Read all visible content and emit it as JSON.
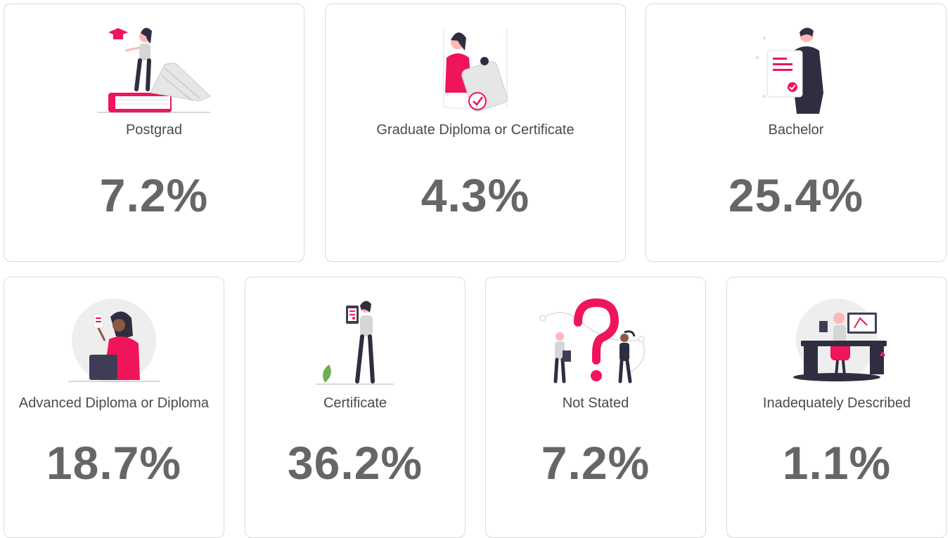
{
  "cards": [
    {
      "label": "Postgrad",
      "value": "7.2%",
      "illustration": "graduate-on-books-icon"
    },
    {
      "label": "Graduate Diploma or Certificate",
      "value": "4.3%",
      "illustration": "woman-holding-certificate-icon"
    },
    {
      "label": "Bachelor",
      "value": "25.4%",
      "illustration": "man-with-document-icon"
    },
    {
      "label": "Advanced Diploma or Diploma",
      "value": "18.7%",
      "illustration": "woman-at-laptop-icon"
    },
    {
      "label": "Certificate",
      "value": "36.2%",
      "illustration": "woman-with-tablet-icon"
    },
    {
      "label": "Not Stated",
      "value": "7.2%",
      "illustration": "question-mark-people-icon"
    },
    {
      "label": "Inadequately Described",
      "value": "1.1%",
      "illustration": "person-at-desk-icon"
    }
  ],
  "colors": {
    "accent": "#f0145a",
    "dark": "#2f2e41",
    "value_text": "#666666",
    "border": "#d9d9d9"
  }
}
